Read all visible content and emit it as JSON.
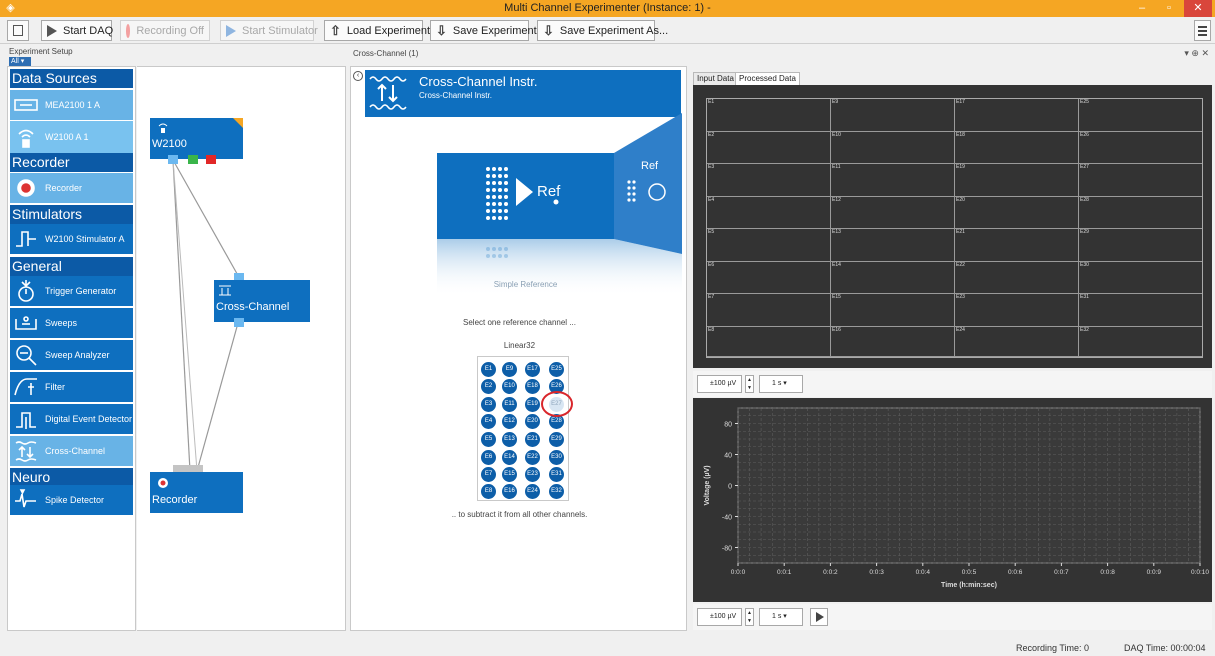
{
  "window": {
    "title": "Multi Channel Experimenter (Instance: 1) -"
  },
  "toolbar": {
    "start_daq": "Start DAQ",
    "recording_off": "Recording Off",
    "start_stimulator": "Start Stimulator",
    "load_experiment": "Load Experiment",
    "save_experiment": "Save Experiment",
    "save_experiment_as": "Save Experiment As..."
  },
  "setup": {
    "title": "Experiment Setup",
    "filter": "All",
    "sections": [
      {
        "title": "Data Sources",
        "items": [
          "MEA2100  1  A",
          "W2100  A  1"
        ]
      },
      {
        "title": "Recorder",
        "items": [
          "Recorder"
        ]
      },
      {
        "title": "Stimulators",
        "items": [
          "W2100 Stimulator  A"
        ]
      },
      {
        "title": "General",
        "items": [
          "Trigger Generator",
          "Sweeps",
          "Sweep Analyzer",
          "Filter",
          "Digital Event Detector",
          "Cross-Channel"
        ]
      },
      {
        "title": "Neuro",
        "items": [
          "Spike Detector"
        ]
      }
    ]
  },
  "canvas": {
    "nodes": {
      "w2100": "W2100",
      "cross_channel": "Cross-Channel",
      "recorder": "Recorder"
    }
  },
  "cross_channel": {
    "dock_title": "Cross-Channel (1)",
    "header_title": "Cross-Channel Instr.",
    "header_sub": "Cross-Channel Instr.",
    "graphic_ref": "Ref",
    "graphic_caption": "Simple Reference",
    "select_text": "Select one reference channel ...",
    "grid_label": "Linear32",
    "subtract_text": ".. to subtract it from all other channels.",
    "electrode_rows": [
      [
        "E1",
        "E9",
        "E17",
        "E25"
      ],
      [
        "E2",
        "E10",
        "E18",
        "E26"
      ],
      [
        "E3",
        "E11",
        "E19",
        "E27"
      ],
      [
        "E4",
        "E12",
        "E20",
        "E28"
      ],
      [
        "E5",
        "E13",
        "E21",
        "E29"
      ],
      [
        "E6",
        "E14",
        "E22",
        "E30"
      ],
      [
        "E7",
        "E15",
        "E23",
        "E31"
      ],
      [
        "E8",
        "E16",
        "E24",
        "E32"
      ]
    ],
    "selected_electrode": "E27"
  },
  "data_panel": {
    "tabs": [
      "Input Data",
      "Processed Data"
    ],
    "active_tab": "Processed Data",
    "channel_columns": [
      [
        "E1",
        "E2",
        "E3",
        "E4",
        "E5",
        "E6",
        "E7",
        "E8"
      ],
      [
        "E9",
        "E10",
        "E11",
        "E12",
        "E13",
        "E14",
        "E15",
        "E16"
      ],
      [
        "E17",
        "E18",
        "E19",
        "E20",
        "E21",
        "E22",
        "E23",
        "E24"
      ],
      [
        "E25",
        "E26",
        "E27",
        "E28",
        "E29",
        "E30",
        "E31",
        "E32"
      ]
    ],
    "range_value": "±100 µV",
    "time_value": "1 s",
    "range_value_2": "±100 µV",
    "time_value_2": "1 s"
  },
  "chart_data": {
    "type": "line",
    "title": "",
    "xlabel": "Time (h:min:sec)",
    "ylabel": "Voltage (µV)",
    "xlim": [
      0.0,
      0.1
    ],
    "ylim": [
      -100,
      100
    ],
    "x_ticks": [
      "0:0:0",
      "0:0:1",
      "0:0:2",
      "0:0:3",
      "0:0:4",
      "0:0:5",
      "0:0:6",
      "0:0:7",
      "0:0:8",
      "0:0:9",
      "0:0:10"
    ],
    "y_ticks": [
      80,
      40,
      0,
      -40,
      -80
    ],
    "grid": true,
    "series": []
  },
  "status": {
    "recording_time": "Recording Time:  0",
    "daq_time": "DAQ Time:  00:00:04"
  }
}
